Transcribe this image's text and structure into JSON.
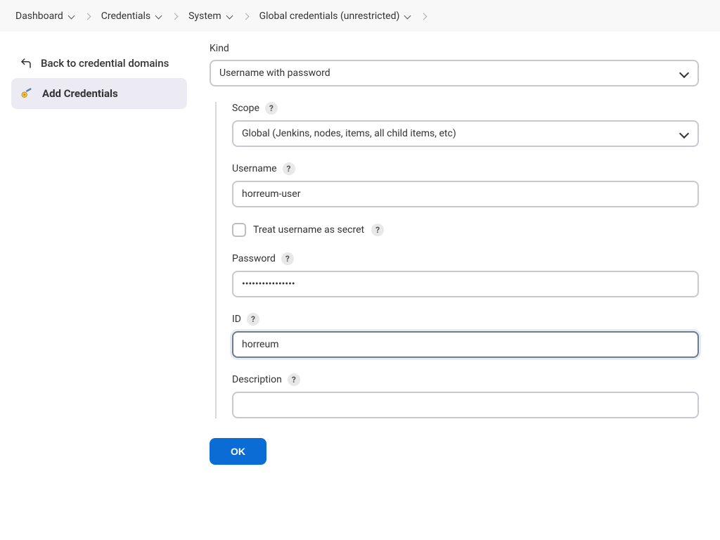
{
  "breadcrumbs": {
    "items": [
      {
        "label": "Dashboard"
      },
      {
        "label": "Credentials"
      },
      {
        "label": "System"
      },
      {
        "label": "Global credentials (unrestricted)"
      }
    ]
  },
  "sidebar": {
    "back_label": "Back to credential domains",
    "add_label": "Add Credentials"
  },
  "form": {
    "kind_label": "Kind",
    "kind_value": "Username with password",
    "scope_label": "Scope",
    "scope_value": "Global (Jenkins, nodes, items, all child items, etc)",
    "username_label": "Username",
    "username_value": "horreum-user",
    "treat_secret_label": "Treat username as secret",
    "treat_secret_checked": false,
    "password_label": "Password",
    "password_value": "••••••••••••••••",
    "id_label": "ID",
    "id_value": "horreum",
    "description_label": "Description",
    "description_value": ""
  },
  "buttons": {
    "ok": "OK"
  },
  "help_mark": "?"
}
